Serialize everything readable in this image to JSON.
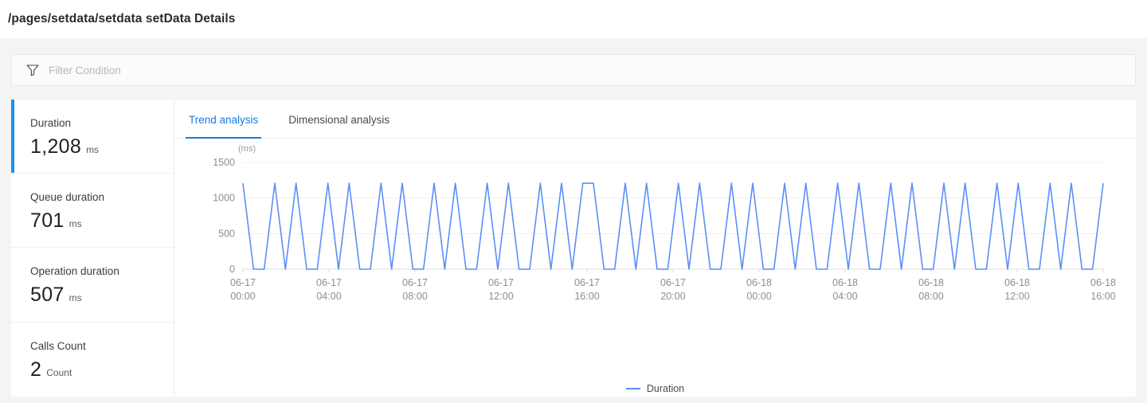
{
  "header": {
    "title": "/pages/setdata/setdata setData Details"
  },
  "filter": {
    "icon": "funnel-icon",
    "value": "",
    "placeholder": "Filter Condition"
  },
  "metrics": [
    {
      "label": "Duration",
      "value": "1,208",
      "unit": "ms",
      "active": true
    },
    {
      "label": "Queue duration",
      "value": "701",
      "unit": "ms",
      "active": false
    },
    {
      "label": "Operation duration",
      "value": "507",
      "unit": "ms",
      "active": false
    },
    {
      "label": "Calls Count",
      "value": "2",
      "unit": "Count",
      "active": false
    }
  ],
  "tabs": [
    {
      "label": "Trend analysis",
      "active": true
    },
    {
      "label": "Dimensional analysis",
      "active": false
    }
  ],
  "colors": {
    "accent": "#1a90f0",
    "tab_active": "#1a7ae0",
    "series_line": "#5b8ff9",
    "grid": "#f0f0f2"
  },
  "chart_data": {
    "type": "line",
    "title": "",
    "unit_label": "(ms)",
    "xlabel": "",
    "ylabel": "",
    "ylim": [
      0,
      1500
    ],
    "yticks": [
      0,
      500,
      1000,
      1500
    ],
    "grid": true,
    "legend_position": "bottom",
    "legend": [
      "Duration"
    ],
    "xtick_labels": [
      "06-17\n00:00",
      "06-17\n04:00",
      "06-17\n08:00",
      "06-17\n12:00",
      "06-17\n16:00",
      "06-17\n20:00",
      "06-18\n00:00",
      "06-18\n04:00",
      "06-18\n08:00",
      "06-18\n12:00",
      "06-18\n16:00"
    ],
    "xticks": [
      {
        "date": "06-17",
        "time": "00:00"
      },
      {
        "date": "06-17",
        "time": "04:00"
      },
      {
        "date": "06-17",
        "time": "08:00"
      },
      {
        "date": "06-17",
        "time": "12:00"
      },
      {
        "date": "06-17",
        "time": "16:00"
      },
      {
        "date": "06-17",
        "time": "20:00"
      },
      {
        "date": "06-18",
        "time": "00:00"
      },
      {
        "date": "06-18",
        "time": "04:00"
      },
      {
        "date": "06-18",
        "time": "08:00"
      },
      {
        "date": "06-18",
        "time": "12:00"
      },
      {
        "date": "06-18",
        "time": "16:00"
      }
    ],
    "series": [
      {
        "name": "Duration",
        "color": "#5b8ff9",
        "values": [
          1208,
          0,
          0,
          1208,
          0,
          1208,
          0,
          0,
          1208,
          0,
          1208,
          0,
          0,
          1208,
          0,
          1208,
          0,
          0,
          1208,
          0,
          1208,
          0,
          0,
          1208,
          0,
          1208,
          0,
          0,
          1208,
          0,
          1208,
          0,
          1208,
          1208,
          0,
          0,
          1208,
          0,
          1208,
          0,
          0,
          1208,
          0,
          1208,
          0,
          0,
          1208,
          0,
          1208,
          0,
          0,
          1208,
          0,
          1208,
          0,
          0,
          1208,
          0,
          1208,
          0,
          0,
          1208,
          0,
          1208,
          0,
          0,
          1208,
          0,
          1208,
          0,
          0,
          1208,
          0,
          1208,
          0,
          0,
          1208,
          0,
          1208,
          0,
          0,
          1208
        ]
      }
    ]
  }
}
